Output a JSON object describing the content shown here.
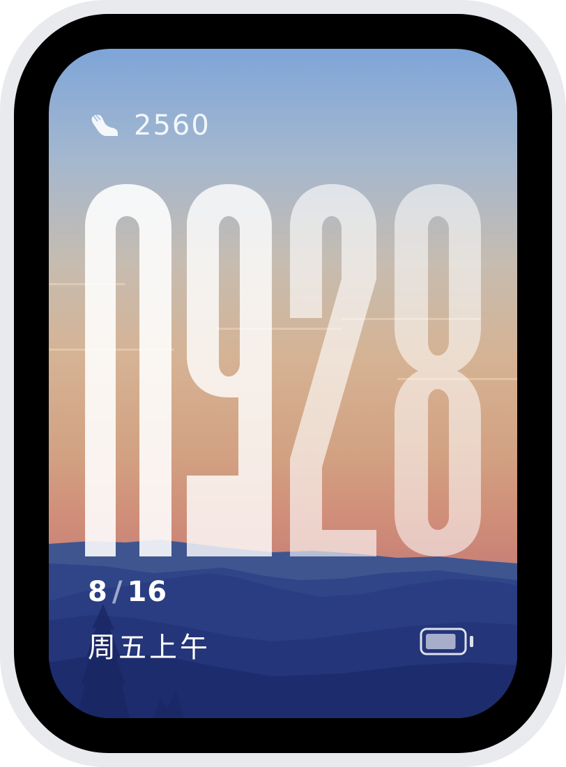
{
  "watchface": {
    "steps": "2560",
    "steps_icon": "shoe-icon",
    "time_digits": [
      "0",
      "9",
      "2",
      "8"
    ],
    "date": {
      "month": "8",
      "separator": "/",
      "day": "16"
    },
    "weekday_period": "周五上午",
    "battery": {
      "icon": "battery-icon",
      "level": 0.85
    }
  },
  "colors": {
    "sky_top": "#7ea5d8",
    "sky_horizon": "#d08e79",
    "mountain_dark": "#22337a",
    "digit_fill": "#ffffff"
  }
}
